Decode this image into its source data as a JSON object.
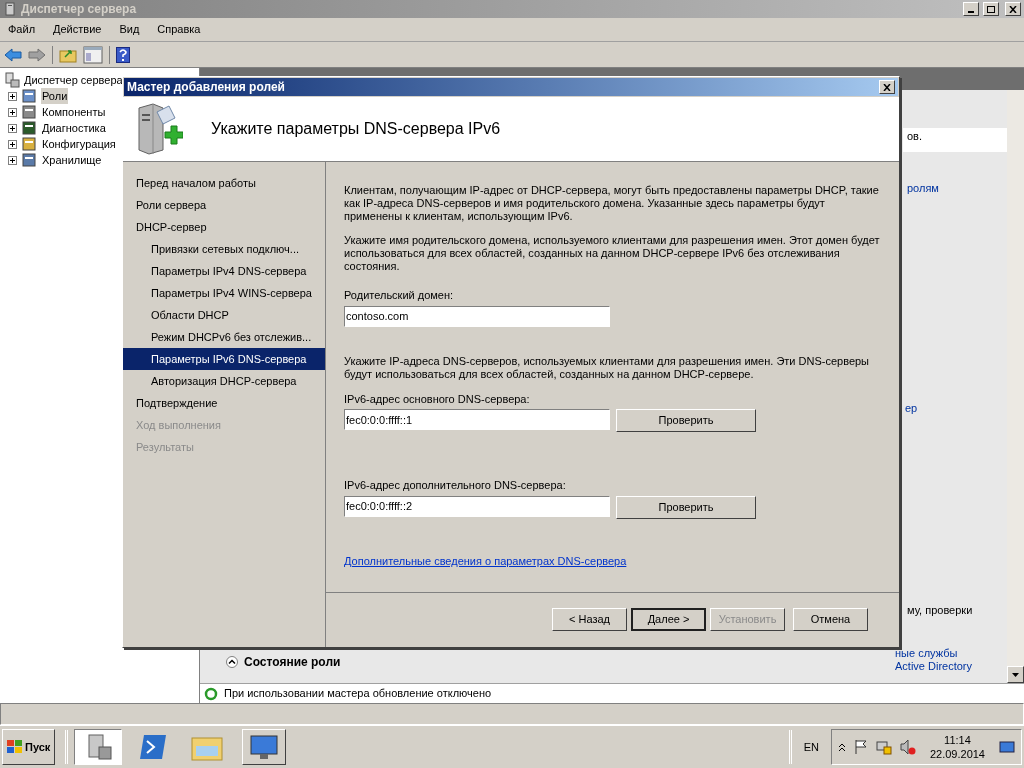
{
  "main_window": {
    "title": "Диспетчер сервера",
    "menu": [
      "Файл",
      "Действие",
      "Вид",
      "Справка"
    ],
    "tree": {
      "label": "Диспетчер сервера",
      "children": [
        {
          "label": "Роли",
          "selected": true,
          "kind": "roles"
        },
        {
          "label": "Компоненты",
          "selected": false,
          "kind": "features"
        },
        {
          "label": "Диагностика",
          "selected": false,
          "kind": "diagnostics"
        },
        {
          "label": "Конфигурация",
          "selected": false,
          "kind": "config"
        },
        {
          "label": "Хранилище",
          "selected": false,
          "kind": "storage"
        }
      ]
    },
    "fragments": [
      "ов.",
      "ролям",
      "ер",
      "му, проверки"
    ],
    "role_status": "Состояние роли",
    "ad_link": [
      "ные службы",
      "Active Directory"
    ],
    "status_text": "При использовании мастера обновление отключено"
  },
  "dialog": {
    "title": "Мастер добавления ролей",
    "heading": "Укажите параметры DNS-сервера IPv6",
    "steps": [
      {
        "label": "Перед началом работы",
        "selected": false,
        "disabled": false
      },
      {
        "label": "Роли сервера",
        "selected": false,
        "disabled": false
      },
      {
        "label": "DHCP-сервер",
        "selected": false,
        "disabled": false,
        "children": [
          {
            "label": "Привязки сетевых подключ...",
            "selected": false,
            "disabled": false
          },
          {
            "label": "Параметры IPv4 DNS-сервера",
            "selected": false,
            "disabled": false
          },
          {
            "label": "Параметры IPv4 WINS-сервера",
            "selected": false,
            "disabled": false
          },
          {
            "label": "Области DHCP",
            "selected": false,
            "disabled": false
          },
          {
            "label": "Режим DHCPv6 без отслежив...",
            "selected": false,
            "disabled": false
          },
          {
            "label": "Параметры IPv6 DNS-сервера",
            "selected": true,
            "disabled": false
          },
          {
            "label": "Авторизация DHCP-сервера",
            "selected": false,
            "disabled": false
          }
        ]
      },
      {
        "label": "Подтверждение",
        "selected": false,
        "disabled": false
      },
      {
        "label": "Ход выполнения",
        "selected": false,
        "disabled": true
      },
      {
        "label": "Результаты",
        "selected": false,
        "disabled": true
      }
    ],
    "intro": [
      "Клиентам, получающим IP-адрес от DHCP-сервера, могут быть предоставлены параметры DHCP, такие как IP-адреса DNS-серверов и имя родительского домена. Указанные здесь параметры будут применены к клиентам, использующим IPv6.",
      "Укажите имя родительского домена, используемого клиентами для разрешения имен. Этот домен будет использоваться для всех областей, созданных на данном DHCP-сервере IPv6 без отслеживания состояния."
    ],
    "domain": {
      "label": "Родительский домен:",
      "value": "contoso.com"
    },
    "dns_intro": "Укажите IP-адреса DNS-серверов, используемых клиентами для разрешения имен. Эти DNS-серверы будут использоваться для всех областей, созданных на данном DHCP-сервере.",
    "dns_fields": [
      {
        "label": "IPv6-адрес основного DNS-сервера:",
        "value": "fec0:0:0:ffff::1",
        "button": "Проверить"
      },
      {
        "label": "IPv6-адрес дополнительного DNS-сервера:",
        "value": "fec0:0:0:ffff::2",
        "button": "Проверить"
      }
    ],
    "link": "Дополнительные сведения о параметрах DNS-сервера",
    "buttons": [
      {
        "label": "< Назад",
        "default": false,
        "disabled": false
      },
      {
        "label": "Далее >",
        "default": true,
        "disabled": false
      },
      {
        "label": "Установить",
        "default": false,
        "disabled": true
      },
      {
        "label": "Отмена",
        "default": false,
        "disabled": false
      }
    ]
  },
  "taskbar": {
    "start": "Пуск",
    "language": "EN",
    "time": "11:14",
    "date": "22.09.2014"
  }
}
